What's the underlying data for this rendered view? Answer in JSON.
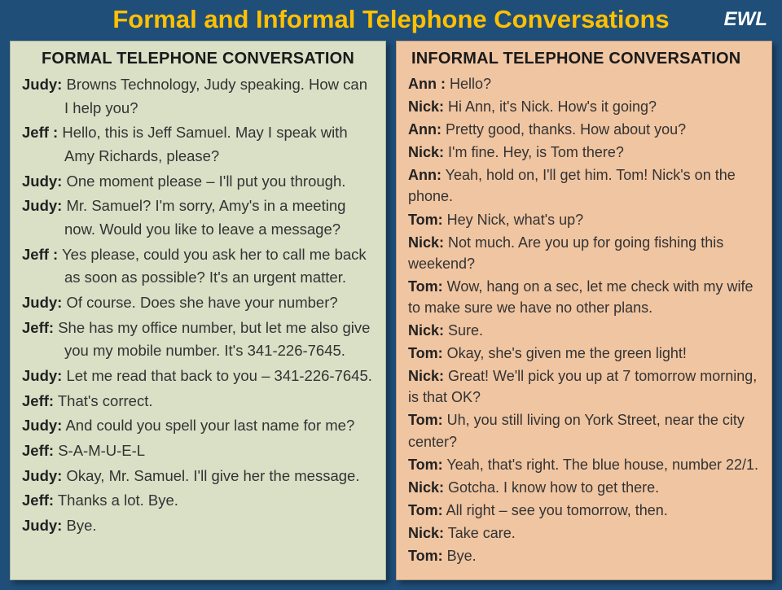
{
  "title": "Formal and Informal Telephone Conversations",
  "badge": "EWL",
  "left": {
    "heading": "FORMAL TELEPHONE CONVERSATION",
    "lines": [
      {
        "speaker": "Judy:",
        "text": " Browns Technology, Judy speaking.  How can I help you?"
      },
      {
        "speaker": "Jeff :",
        "text": " Hello, this is Jeff Samuel. May I speak with Amy Richards, please?"
      },
      {
        "speaker": "Judy:",
        "text": " One moment please – I'll put you through."
      },
      {
        "speaker": "Judy:",
        "text": " Mr. Samuel? I'm sorry, Amy's in a meeting now. Would you like to leave a message?"
      },
      {
        "speaker": "Jeff :",
        "text": " Yes please, could you ask her to call me back as soon as possible? It's an urgent matter."
      },
      {
        "speaker": "Judy:",
        "text": " Of course. Does she have your number?"
      },
      {
        "speaker": "Jeff:",
        "text": " She has my office number, but let me also give you my mobile number. It's 341-226-7645."
      },
      {
        "speaker": "Judy:",
        "text": " Let me read that back to you – 341-226-7645."
      },
      {
        "speaker": "Jeff:",
        "text": "  That's correct."
      },
      {
        "speaker": "Judy:",
        "text": " And could you spell your last name for me?"
      },
      {
        "speaker": "Jeff:",
        "text": " S-A-M-U-E-L"
      },
      {
        "speaker": "Judy:",
        "text": " Okay, Mr. Samuel. I'll give her the message."
      },
      {
        "speaker": "Jeff:",
        "text": " Thanks a lot. Bye."
      },
      {
        "speaker": "Judy:",
        "text": " Bye."
      }
    ]
  },
  "right": {
    "heading": "INFORMAL TELEPHONE CONVERSATION",
    "lines": [
      {
        "speaker": "Ann :",
        "text": " Hello?"
      },
      {
        "speaker": "Nick:",
        "text": " Hi Ann, it's Nick. How's it going?"
      },
      {
        "speaker": "Ann:",
        "text": " Pretty good, thanks. How about you?"
      },
      {
        "speaker": "Nick:",
        "text": " I'm fine. Hey, is Tom there?"
      },
      {
        "speaker": "Ann:",
        "text": " Yeah, hold on, I'll get him. Tom! Nick's on the phone."
      },
      {
        "speaker": "Tom:",
        "text": " Hey Nick, what's up?"
      },
      {
        "speaker": "Nick:",
        "text": " Not much. Are you up for going fishing this weekend?"
      },
      {
        "speaker": "Tom:",
        "text": " Wow, hang on a sec, let me check with my wife to make sure we have no other plans."
      },
      {
        "speaker": "Nick:",
        "text": " Sure."
      },
      {
        "speaker": "Tom:",
        "text": " Okay, she's given me the green light!"
      },
      {
        "speaker": "Nick:",
        "text": " Great! We'll pick you up at 7 tomorrow morning, is that OK?"
      },
      {
        "speaker": "Tom:",
        "text": " Uh, you still living on York Street, near the city center?"
      },
      {
        "speaker": "Tom:",
        "text": " Yeah, that's right. The blue house, number 22/1."
      },
      {
        "speaker": "Nick:",
        "text": " Gotcha. I know how to get there."
      },
      {
        "speaker": "Tom:",
        "text": " All right – see you tomorrow, then."
      },
      {
        "speaker": "Nick:",
        "text": " Take care."
      },
      {
        "speaker": "Tom:",
        "text": " Bye."
      }
    ]
  }
}
